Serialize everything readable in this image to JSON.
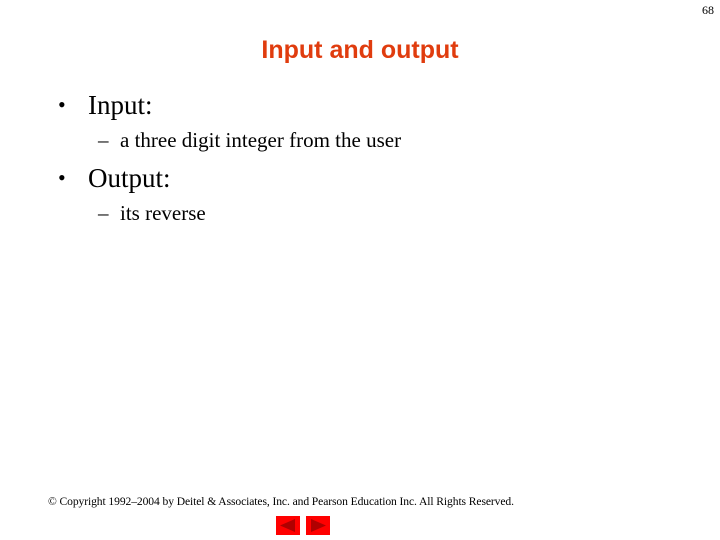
{
  "slide": {
    "page_number": "68",
    "title": "Input and output",
    "title_color": "#e03c0e",
    "bullets": [
      {
        "mark": "•",
        "text": "Input:",
        "sub": {
          "mark": "–",
          "text": "a three digit integer from the user"
        }
      },
      {
        "mark": "•",
        "text": "Output:",
        "sub": {
          "mark": "–",
          "text": "its reverse"
        }
      }
    ],
    "footer": {
      "copyright": "© Copyright 1992–2004 by Deitel & Associates, Inc. and Pearson Education Inc. All Rights Reserved."
    },
    "nav": {
      "button_color": "#ff0000",
      "arrow_color": "#b00000",
      "prev_icon": "triangle-left-icon",
      "next_icon": "triangle-right-icon"
    }
  }
}
